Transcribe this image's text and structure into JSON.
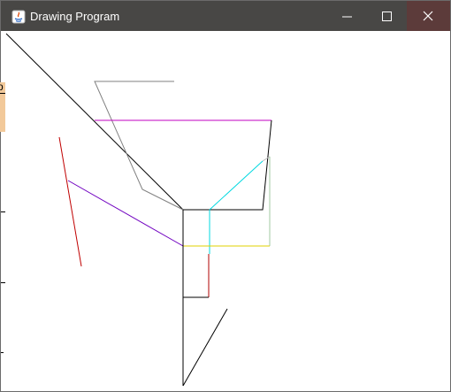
{
  "window": {
    "title": "Drawing Program",
    "controls": {
      "minimize": "minimize",
      "maximize": "maximize",
      "close": "close"
    },
    "colors": {
      "titlebar": "#484745",
      "close_bg": "#5c3b3a",
      "canvas": "#ffffff"
    }
  },
  "canvas": {
    "stroke_colors": {
      "black": "#000000",
      "gray": "#808080",
      "magenta": "#c000c0",
      "red": "#c00000",
      "purple": "#7000c0",
      "cyan": "#00e0e0",
      "yellow": "#e0d000",
      "light_gray": "#bdbdbd",
      "dark_red": "#b00000"
    }
  },
  "background_window": {
    "partial_glyph": "p"
  }
}
